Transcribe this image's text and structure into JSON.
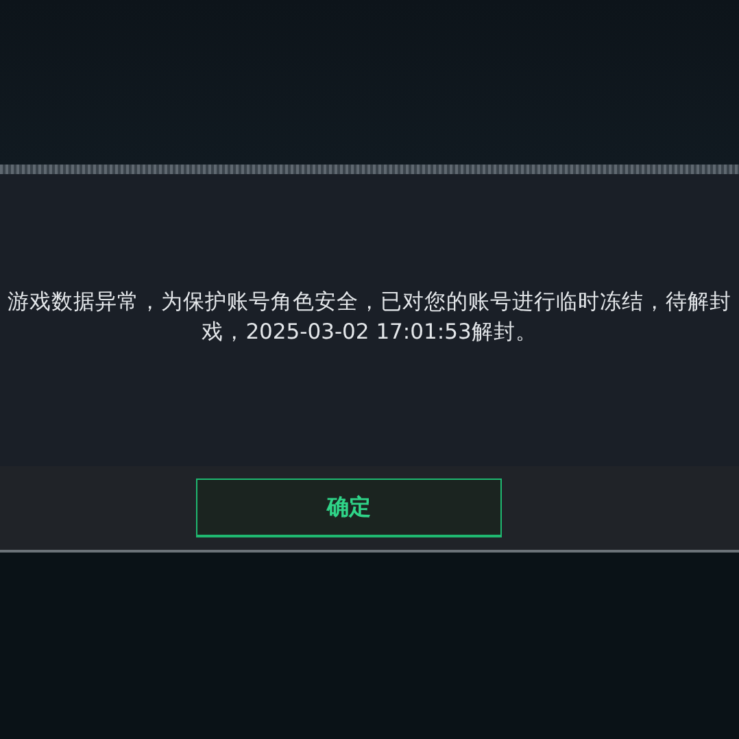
{
  "dialog": {
    "message_lines": [
      "游戏数据异常，为保护账号角色安全，已对您的账号进行临时冻结，待解封",
      "戏，2025-03-02 17:01:53解封。"
    ],
    "confirm_button": {
      "label": "确定"
    }
  }
}
